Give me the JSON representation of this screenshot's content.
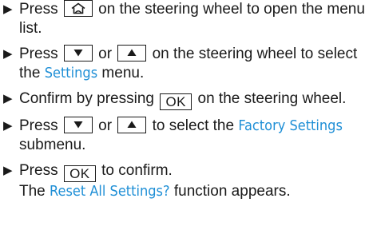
{
  "steps": [
    {
      "pre": "Press",
      "key": "home-icon",
      "post": "on the steering wheel to open the menu list."
    },
    {
      "pre": "Press",
      "key1": "down-arrow-icon",
      "mid": "or",
      "key2": "up-arrow-icon",
      "post1": "on the steering wheel to select the",
      "display": "Settings",
      "post2": "menu."
    },
    {
      "pre": "Confirm by pressing",
      "key": "OK",
      "post": "on the steering wheel."
    },
    {
      "pre": "Press",
      "key1": "down-arrow-icon",
      "mid": "or",
      "key2": "up-arrow-icon",
      "post1": "to select the",
      "display": "Factory Settings",
      "post2": "submenu."
    },
    {
      "pre": "Press",
      "key": "OK",
      "post": "to confirm.",
      "result_pre": "The",
      "result_display": "Reset All Settings?",
      "result_post": "function appears."
    }
  ],
  "colors": {
    "display_text": "#1f8fd6",
    "body_text": "#1a1a1a"
  }
}
